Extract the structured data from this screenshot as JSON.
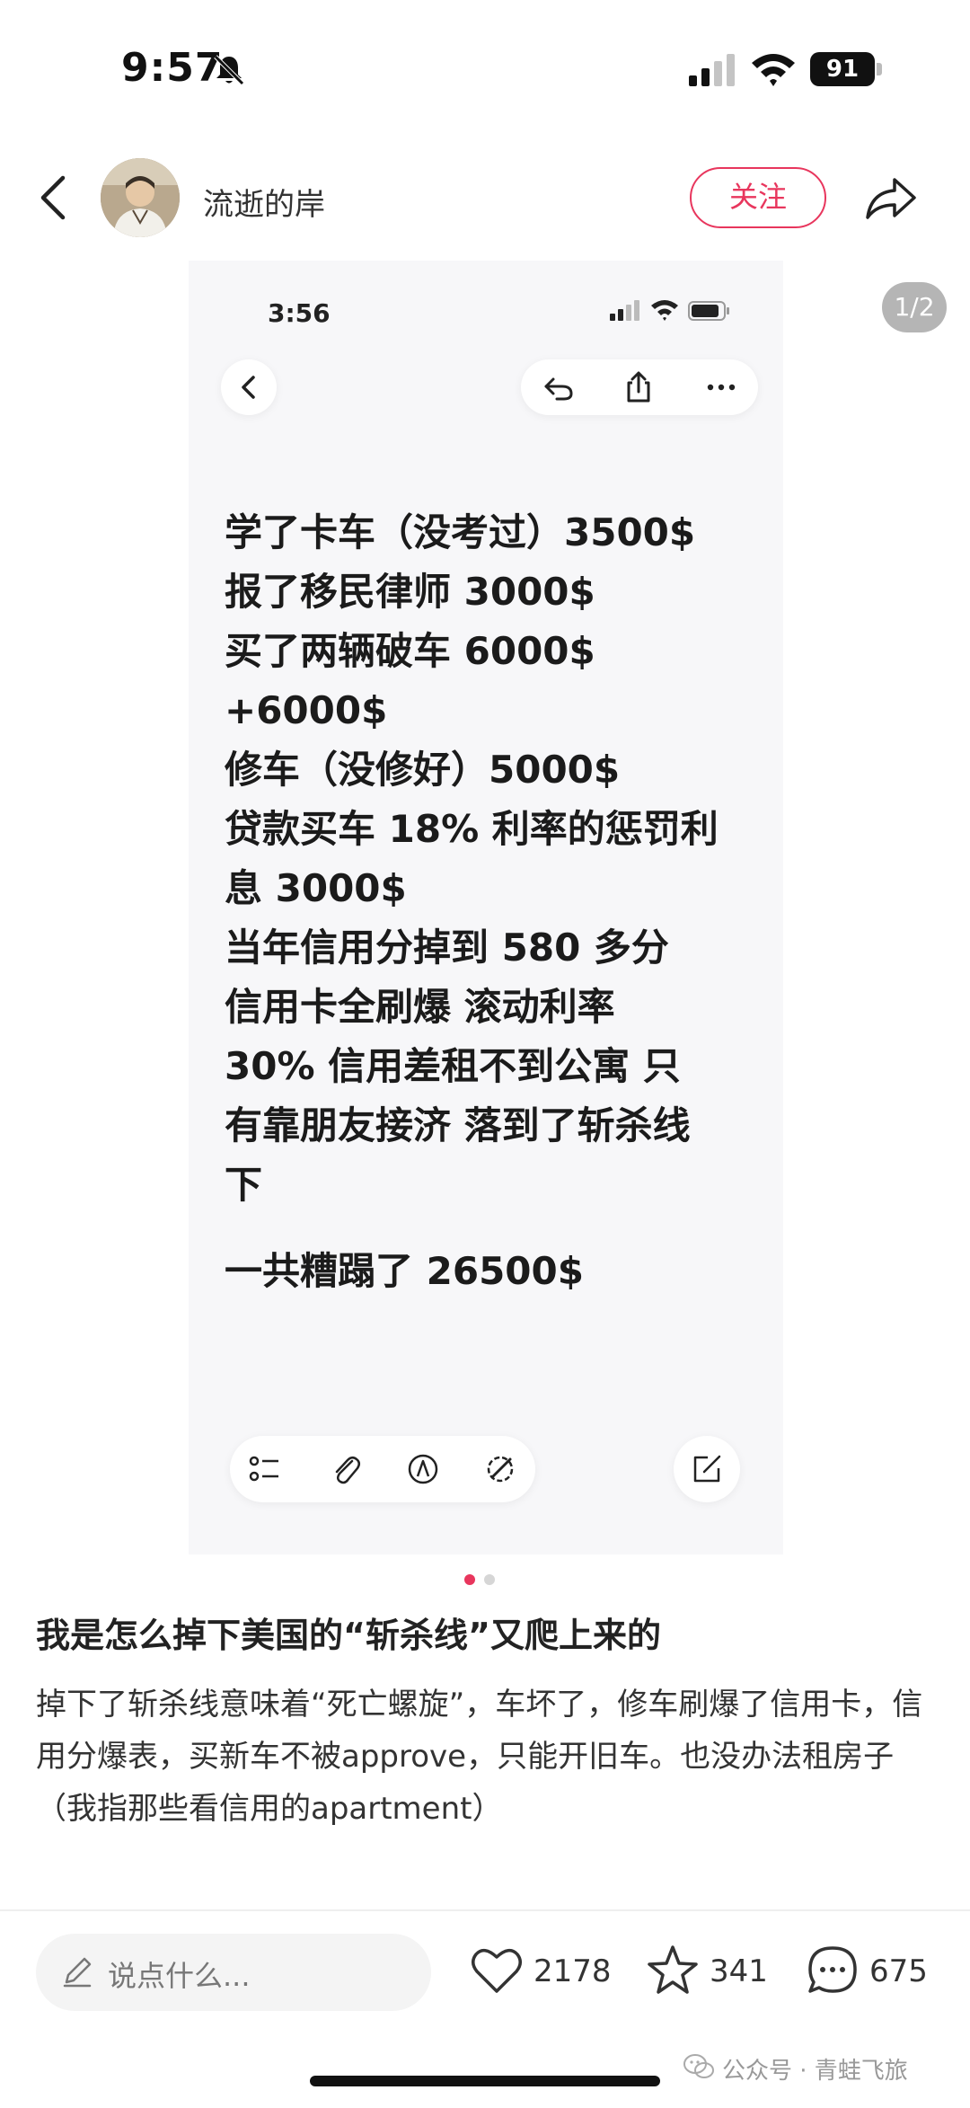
{
  "status_bar": {
    "time": "9:57",
    "battery_level": "91"
  },
  "header": {
    "author_name": "流逝的岸",
    "follow_label": "关注"
  },
  "image": {
    "page_counter": "1/2",
    "inner_status_time": "3:56",
    "note_lines": "学了卡车（没考过）3500$\n报了移民律师 3000$\n买了两辆破车 6000$\n+6000$\n修车（没修好）5000$\n贷款买车 18% 利率的惩罚利\n息 3000$\n当年信用分掉到 580 多分\n信用卡全刷爆 滚动利率\n 30% 信用差租不到公寓 只\n有靠朋友接济 落到了斩杀线\n下",
    "note_total": "一共糟蹋了 26500$",
    "current_page": 1,
    "total_pages": 2
  },
  "post": {
    "title": "我是怎么掉下美国的“斩杀线”又爬上来的",
    "body": "掉下了斩杀线意味着“死亡螺旋”，车坏了，修车刷爆了信用卡，信用分爆表，买新车不被approve，只能开旧车。也没办法租房子（我指那些看信用的apartment）"
  },
  "bottom_bar": {
    "comment_placeholder": "说点什么...",
    "likes": "2178",
    "favorites": "341",
    "comments": "675"
  },
  "watermark": {
    "text": "公众号 · 青蛙飞旅"
  },
  "colors": {
    "accent": "#e8365d",
    "text_primary": "#222222",
    "text_secondary": "#333333",
    "image_bg": "#f7f7f9"
  }
}
